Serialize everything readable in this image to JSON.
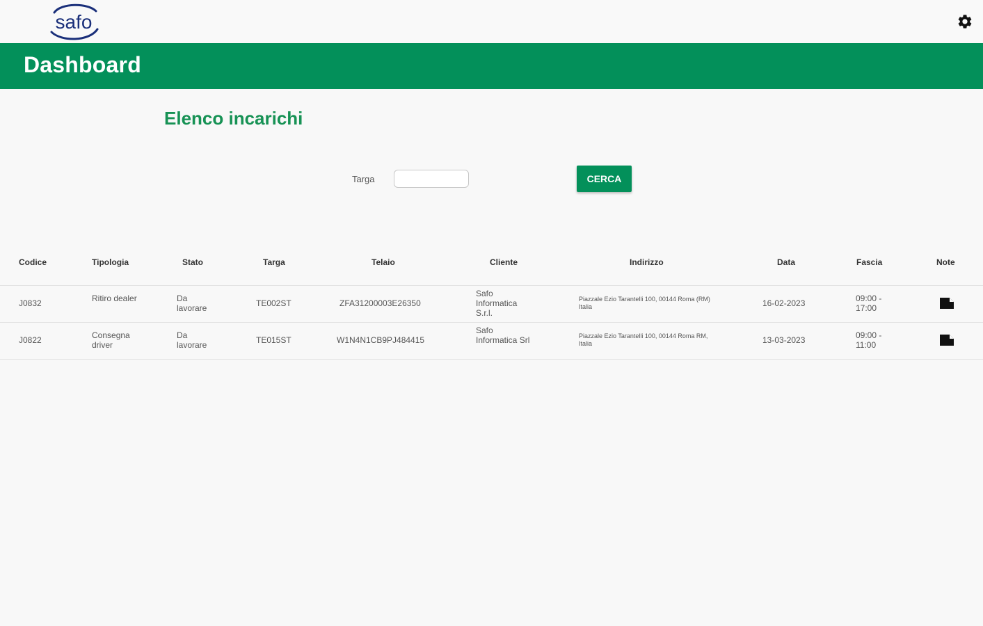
{
  "brand": {
    "logo_text": "safo",
    "logo_color": "#1a2f7a"
  },
  "header": {
    "title": "Dashboard",
    "background": "#03905a"
  },
  "page": {
    "section_title": "Elenco incarichi"
  },
  "search": {
    "label": "Targa",
    "value": "",
    "button_label": "CERCA"
  },
  "table": {
    "headers": [
      "Codice",
      "Tipologia",
      "Stato",
      "Targa",
      "Telaio",
      "Cliente",
      "Indirizzo",
      "Data",
      "Fascia",
      "Note"
    ],
    "rows": [
      {
        "codice": "J0832",
        "tipologia": "Ritiro dealer",
        "stato": "Da lavorare",
        "targa": "TE002ST",
        "telaio": "ZFA31200003E26350",
        "cliente": "Safo Informatica S.r.l.",
        "indirizzo": "Piazzale Ezio Tarantelli 100, 00144 Roma (RM) Italia",
        "data": "16-02-2023",
        "fascia": "09:00 - 17:00",
        "note_icon": "note-icon"
      },
      {
        "codice": "J0822",
        "tipologia": "Consegna driver",
        "stato": "Da lavorare",
        "targa": "TE015ST",
        "telaio": "W1N4N1CB9PJ484415",
        "cliente": "Safo Informatica Srl",
        "indirizzo": "Piazzale Ezio Tarantelli 100, 00144 Roma RM, Italia",
        "data": "13-03-2023",
        "fascia": "09:00 - 11:00",
        "note_icon": "note-icon"
      }
    ]
  },
  "icons": {
    "settings": "gear-icon",
    "note": "note-icon"
  }
}
